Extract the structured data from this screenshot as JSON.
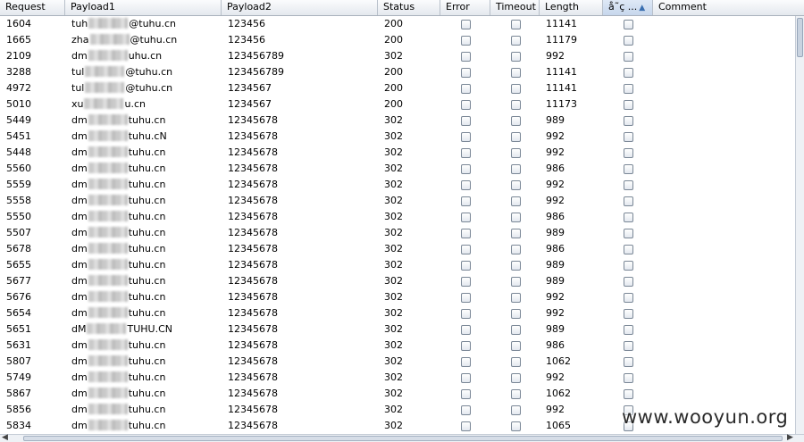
{
  "columns": [
    "Request",
    "Payload1",
    "Payload2",
    "Status",
    "Error",
    "Timeout",
    "Length",
    "å˜­ç ...",
    "Comment"
  ],
  "sorted_column": "å˜­ç ...",
  "rows": [
    {
      "request": "1604",
      "p1a": "tuh",
      "p1b": "@tuhu.cn",
      "payload2": "123456",
      "status": "200",
      "length": "11141"
    },
    {
      "request": "1665",
      "p1a": "zha",
      "p1b": "@tuhu.cn",
      "payload2": "123456",
      "status": "200",
      "length": "11179"
    },
    {
      "request": "2109",
      "p1a": "dm",
      "p1b": "uhu.cn",
      "payload2": "123456789",
      "status": "302",
      "length": "992"
    },
    {
      "request": "3288",
      "p1a": "tul",
      "p1b": "@tuhu.cn",
      "payload2": "123456789",
      "status": "200",
      "length": "11141"
    },
    {
      "request": "4972",
      "p1a": "tul",
      "p1b": "@tuhu.cn",
      "payload2": "1234567",
      "status": "200",
      "length": "11141"
    },
    {
      "request": "5010",
      "p1a": "xu",
      "p1b": "u.cn",
      "payload2": "1234567",
      "status": "200",
      "length": "11173"
    },
    {
      "request": "5449",
      "p1a": "dm",
      "p1b": "tuhu.cn",
      "payload2": "12345678",
      "status": "302",
      "length": "989"
    },
    {
      "request": "5451",
      "p1a": "dm",
      "p1b": "tuhu.cN",
      "payload2": "12345678",
      "status": "302",
      "length": "992"
    },
    {
      "request": "5448",
      "p1a": "dm",
      "p1b": "tuhu.cn",
      "payload2": "12345678",
      "status": "302",
      "length": "992"
    },
    {
      "request": "5560",
      "p1a": "dm",
      "p1b": "tuhu.cn",
      "payload2": "12345678",
      "status": "302",
      "length": "986"
    },
    {
      "request": "5559",
      "p1a": "dm",
      "p1b": "tuhu.cn",
      "payload2": "12345678",
      "status": "302",
      "length": "992"
    },
    {
      "request": "5558",
      "p1a": "dm",
      "p1b": "tuhu.cn",
      "payload2": "12345678",
      "status": "302",
      "length": "992"
    },
    {
      "request": "5550",
      "p1a": "dm",
      "p1b": "tuhu.cn",
      "payload2": "12345678",
      "status": "302",
      "length": "986"
    },
    {
      "request": "5507",
      "p1a": "dm",
      "p1b": "tuhu.cn",
      "payload2": "12345678",
      "status": "302",
      "length": "989"
    },
    {
      "request": "5678",
      "p1a": "dm",
      "p1b": "tuhu.cn",
      "payload2": "12345678",
      "status": "302",
      "length": "986"
    },
    {
      "request": "5655",
      "p1a": "dm",
      "p1b": "tuhu.cn",
      "payload2": "12345678",
      "status": "302",
      "length": "989"
    },
    {
      "request": "5677",
      "p1a": "dm",
      "p1b": "tuhu.cn",
      "payload2": "12345678",
      "status": "302",
      "length": "989"
    },
    {
      "request": "5676",
      "p1a": "dm",
      "p1b": "tuhu.cn",
      "payload2": "12345678",
      "status": "302",
      "length": "992"
    },
    {
      "request": "5654",
      "p1a": "dm",
      "p1b": "tuhu.cn",
      "payload2": "12345678",
      "status": "302",
      "length": "992"
    },
    {
      "request": "5651",
      "p1a": "dM",
      "p1b": "TUHU.CN",
      "payload2": "12345678",
      "status": "302",
      "length": "989"
    },
    {
      "request": "5631",
      "p1a": "dm",
      "p1b": "tuhu.cn",
      "payload2": "12345678",
      "status": "302",
      "length": "986"
    },
    {
      "request": "5807",
      "p1a": "dm",
      "p1b": "tuhu.cn",
      "payload2": "12345678",
      "status": "302",
      "length": "1062"
    },
    {
      "request": "5749",
      "p1a": "dm",
      "p1b": "tuhu.cn",
      "payload2": "12345678",
      "status": "302",
      "length": "992"
    },
    {
      "request": "5867",
      "p1a": "dm",
      "p1b": "tuhu.cn",
      "payload2": "12345678",
      "status": "302",
      "length": "1062"
    },
    {
      "request": "5856",
      "p1a": "dm",
      "p1b": "tuhu.cn",
      "payload2": "12345678",
      "status": "302",
      "length": "992"
    },
    {
      "request": "5834",
      "p1a": "dm",
      "p1b": "tuhu.cn",
      "payload2": "12345678",
      "status": "302",
      "length": "1065"
    }
  ],
  "watermark": "www.wooyun.org",
  "colors": {
    "header_bg": "#e4e8ee",
    "sorted_header_bg": "#c6d6ec",
    "grid_border": "#b8c0ca"
  }
}
